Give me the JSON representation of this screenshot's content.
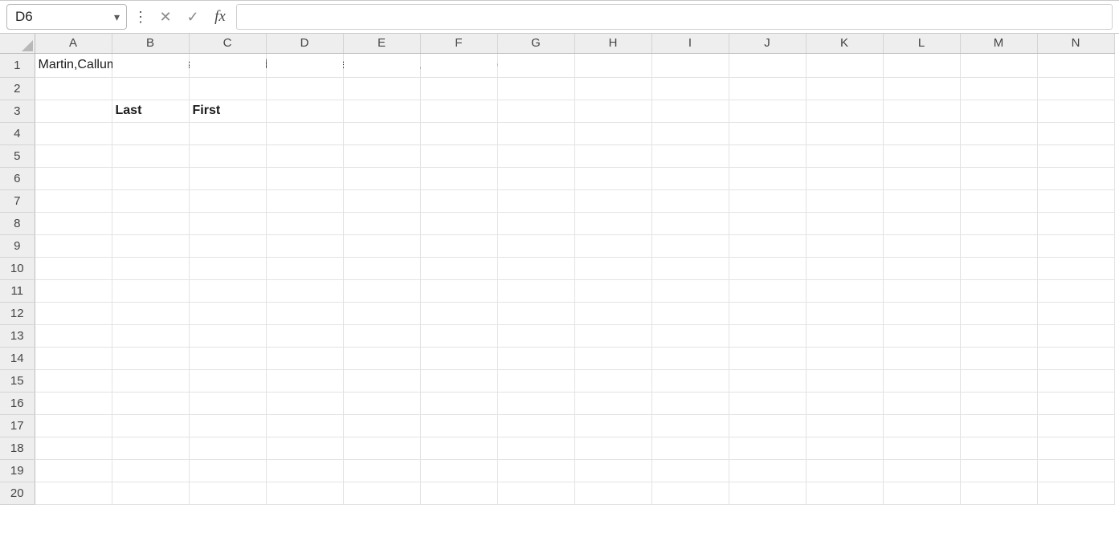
{
  "formula_bar": {
    "name_box_value": "D6",
    "cancel_glyph": "✕",
    "confirm_glyph": "✓",
    "fx_glyph": "fx",
    "formula_value": ""
  },
  "columns": [
    {
      "letter": "A",
      "width": 96
    },
    {
      "letter": "B",
      "width": 96
    },
    {
      "letter": "C",
      "width": 96
    },
    {
      "letter": "D",
      "width": 96
    },
    {
      "letter": "E",
      "width": 96
    },
    {
      "letter": "F",
      "width": 96
    },
    {
      "letter": "G",
      "width": 96
    },
    {
      "letter": "H",
      "width": 96
    },
    {
      "letter": "I",
      "width": 96
    },
    {
      "letter": "J",
      "width": 96
    },
    {
      "letter": "K",
      "width": 96
    },
    {
      "letter": "L",
      "width": 96
    },
    {
      "letter": "M",
      "width": 96
    },
    {
      "letter": "N",
      "width": 96
    }
  ],
  "row_count": 20,
  "active_cell": {
    "row": 6,
    "col": "D"
  },
  "cells": {
    "A1": {
      "value": "Martin,Callum;Stevens,Joseph;Coulhard,Melissa;Scheff,Brian;Diaz,Marcus;Hansen,Jill",
      "bold": false,
      "overflow": true
    },
    "B3": {
      "value": "Last",
      "bold": true
    },
    "C3": {
      "value": "First",
      "bold": true
    }
  }
}
